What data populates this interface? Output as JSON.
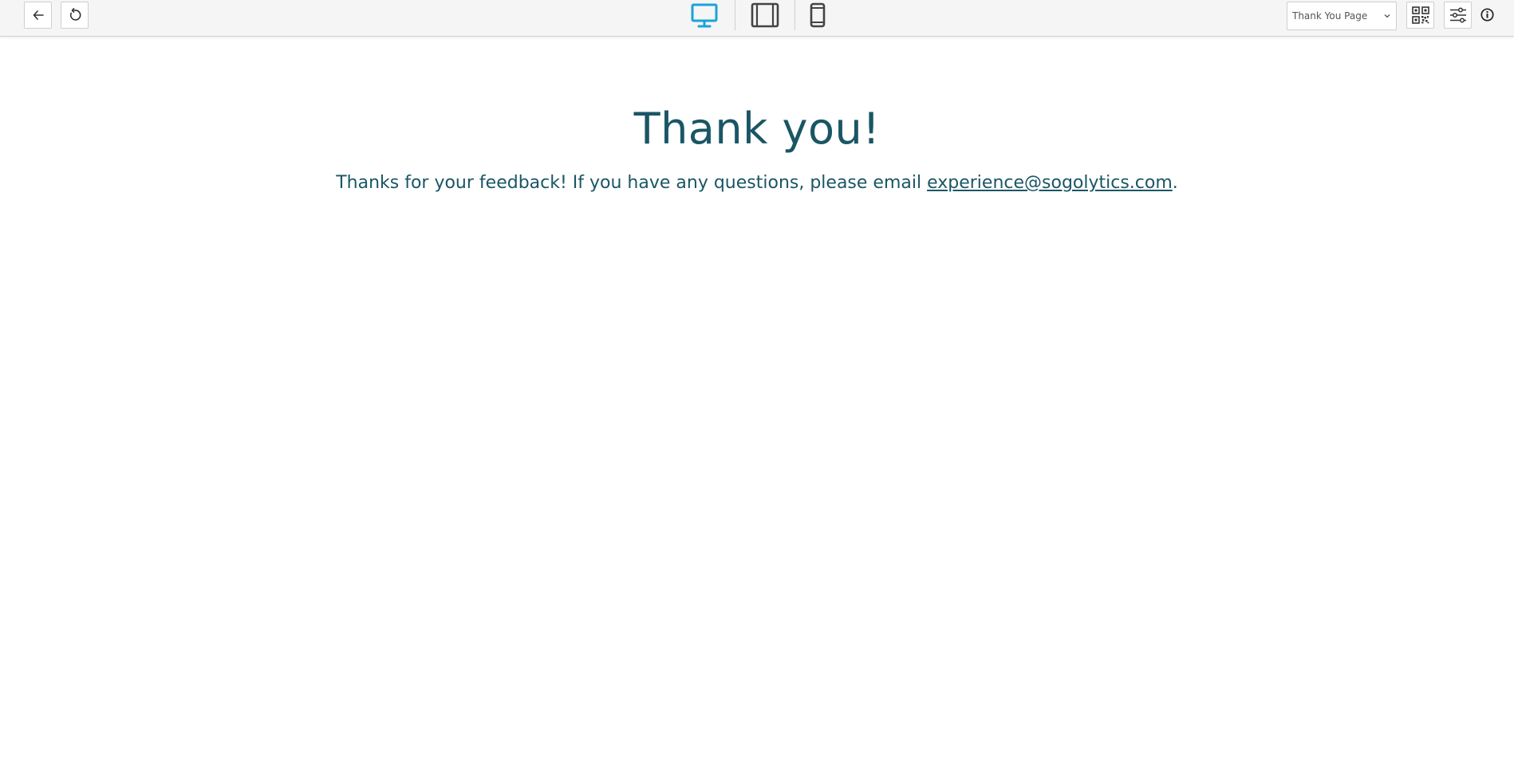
{
  "toolbar": {
    "back_button": "back",
    "refresh_button": "refresh",
    "devices": [
      {
        "name": "desktop",
        "icon": "desktop-icon",
        "active": true
      },
      {
        "name": "tablet",
        "icon": "tablet-icon",
        "active": false
      },
      {
        "name": "mobile",
        "icon": "mobile-icon",
        "active": false
      }
    ],
    "page_select_value": "Thank You Page",
    "icons": {
      "qr": "qr-code-icon",
      "settings": "sliders-icon",
      "info": "info-icon"
    },
    "colors": {
      "active_device": "#1aa3d9",
      "inactive_device": "#444444"
    }
  },
  "content": {
    "title": "Thank you!",
    "message_prefix": "Thanks for your feedback! If you have any questions, please email ",
    "email": "experience@sogolytics.com",
    "message_suffix": ".",
    "text_color": "#1a5665"
  }
}
